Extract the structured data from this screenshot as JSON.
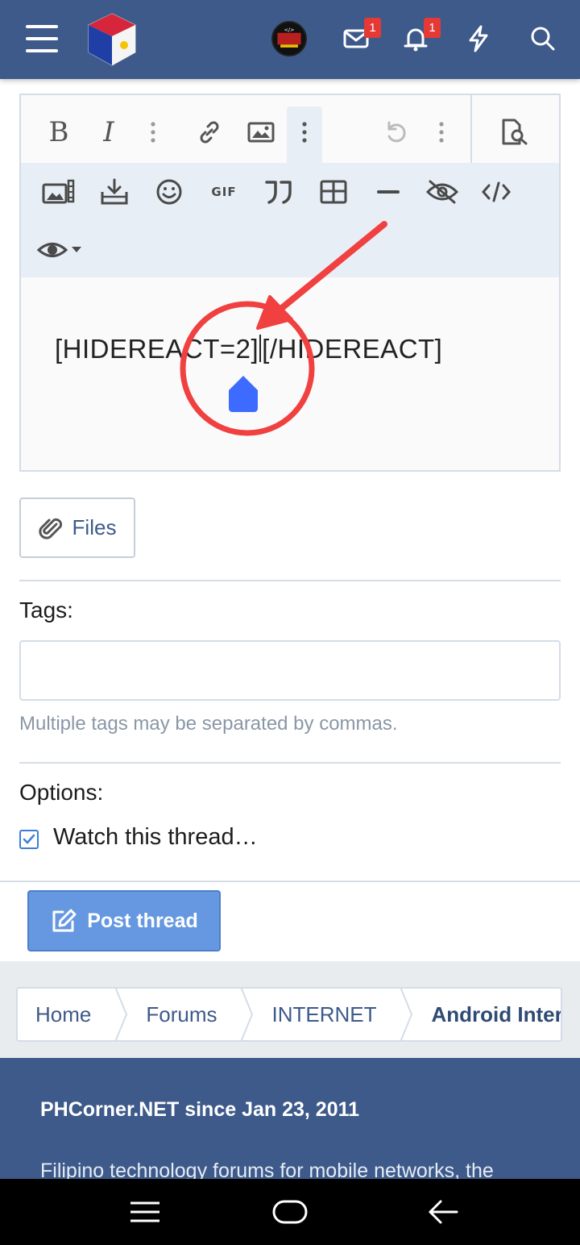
{
  "header": {
    "menu_icon": "hamburger-icon",
    "logo": "site-logo",
    "messages_badge": "1",
    "alerts_badge": "1",
    "icons": [
      "envelope-icon",
      "bell-icon",
      "bolt-icon",
      "search-icon"
    ]
  },
  "editor": {
    "toolbar_row1": [
      "bold-icon",
      "italic-icon",
      "more-vertical-icon",
      "link-icon",
      "image-icon",
      "more-vertical-icon",
      "undo-icon",
      "more-vertical-icon",
      "preview-icon"
    ],
    "toolbar_row2": [
      "gallery-icon",
      "insert-media-icon",
      "smiley-icon",
      "gif-icon",
      "quote-icon",
      "table-icon",
      "horizontal-rule-icon",
      "hide-icon",
      "code-icon",
      "visibility-dropdown-icon"
    ],
    "gif_label": "GIF",
    "content_before_caret": "[HIDEREACT=2]",
    "content_after_caret": "[/HIDEREACT]"
  },
  "files_button": {
    "label": "Files"
  },
  "tags": {
    "label": "Tags:",
    "value": "",
    "hint": "Multiple tags may be separated by commas."
  },
  "options": {
    "label": "Options:",
    "watch_label": "Watch this thread…",
    "watch_checked": true
  },
  "post_button": {
    "label": "Post thread"
  },
  "breadcrumbs": [
    "Home",
    "Forums",
    "INTERNET",
    "Android Internet Tricks"
  ],
  "footer": {
    "title": "PHCorner.NET since Jan 23, 2011",
    "text": "Filipino technology forums for mobile networks, the"
  },
  "colors": {
    "header": "#3d5a8a",
    "accent": "#6598e0",
    "annotation": "#f04040",
    "cursor_handle": "#3d6bff"
  }
}
